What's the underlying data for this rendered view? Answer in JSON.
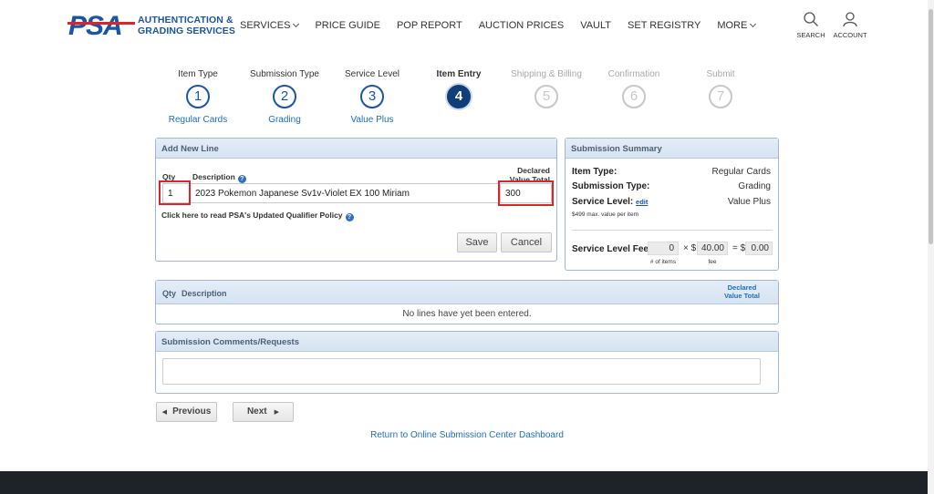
{
  "header": {
    "brand_line1": "AUTHENTICATION &",
    "brand_line2": "GRADING SERVICES",
    "logo_text": "PSA",
    "nav": [
      {
        "label": "SERVICES",
        "has_chevron": true
      },
      {
        "label": "PRICE GUIDE"
      },
      {
        "label": "POP REPORT"
      },
      {
        "label": "AUCTION PRICES"
      },
      {
        "label": "VAULT"
      },
      {
        "label": "SET REGISTRY"
      },
      {
        "label": "MORE",
        "has_chevron": true
      }
    ],
    "search_label": "SEARCH",
    "account_label": "ACCOUNT"
  },
  "steps": [
    {
      "num": "1",
      "label": "Item Type",
      "sub": "Regular Cards",
      "state": "done"
    },
    {
      "num": "2",
      "label": "Submission Type",
      "sub": "Grading",
      "state": "done"
    },
    {
      "num": "3",
      "label": "Service Level",
      "sub": "Value Plus",
      "state": "done"
    },
    {
      "num": "4",
      "label": "Item Entry",
      "sub": "",
      "state": "active"
    },
    {
      "num": "5",
      "label": "Shipping & Billing",
      "sub": "",
      "state": "todo"
    },
    {
      "num": "6",
      "label": "Confirmation",
      "sub": "",
      "state": "todo"
    },
    {
      "num": "7",
      "label": "Submit",
      "sub": "",
      "state": "todo"
    }
  ],
  "add_line": {
    "title": "Add New Line",
    "qty_label": "Qty",
    "desc_label": "Description",
    "declared_label_1": "Declared",
    "declared_label_2": "Value Total",
    "qty_value": "1",
    "desc_value": "2023 Pokemon Japanese Sv1v-Violet EX 100 Miriam",
    "declared_value": "300",
    "policy_link": "Click here to read PSA's Updated Qualifier Policy",
    "save_label": "Save",
    "cancel_label": "Cancel"
  },
  "summary": {
    "title": "Submission Summary",
    "item_type_key": "Item Type:",
    "item_type_val": "Regular Cards",
    "submission_type_key": "Submission Type:",
    "submission_type_val": "Grading",
    "service_level_key": "Service Level:",
    "service_level_edit": "edit",
    "service_level_val": "Value Plus",
    "max_note": "$499 max. value per item",
    "fee_key": "Service Level Fee:",
    "items_count": "0",
    "times": "× $",
    "fee": "40.00",
    "equals": "= $",
    "total": "0.00",
    "items_caption": "# of items",
    "fee_caption": "fee"
  },
  "lines_table": {
    "col_qty": "Qty",
    "col_desc": "Description",
    "col_declared_1": "Declared",
    "col_declared_2": "Value Total",
    "empty_message": "No lines have yet been entered."
  },
  "comments": {
    "title": "Submission Comments/Requests",
    "value": ""
  },
  "nav_buttons": {
    "previous": "Previous",
    "next": "Next"
  },
  "return_link": "Return to Online Submission Center Dashboard",
  "colors": {
    "brand_blue": "#1a55a6",
    "active_step": "#0f3e7a",
    "highlight_red": "#d9262b",
    "footer": "#1e2229"
  }
}
